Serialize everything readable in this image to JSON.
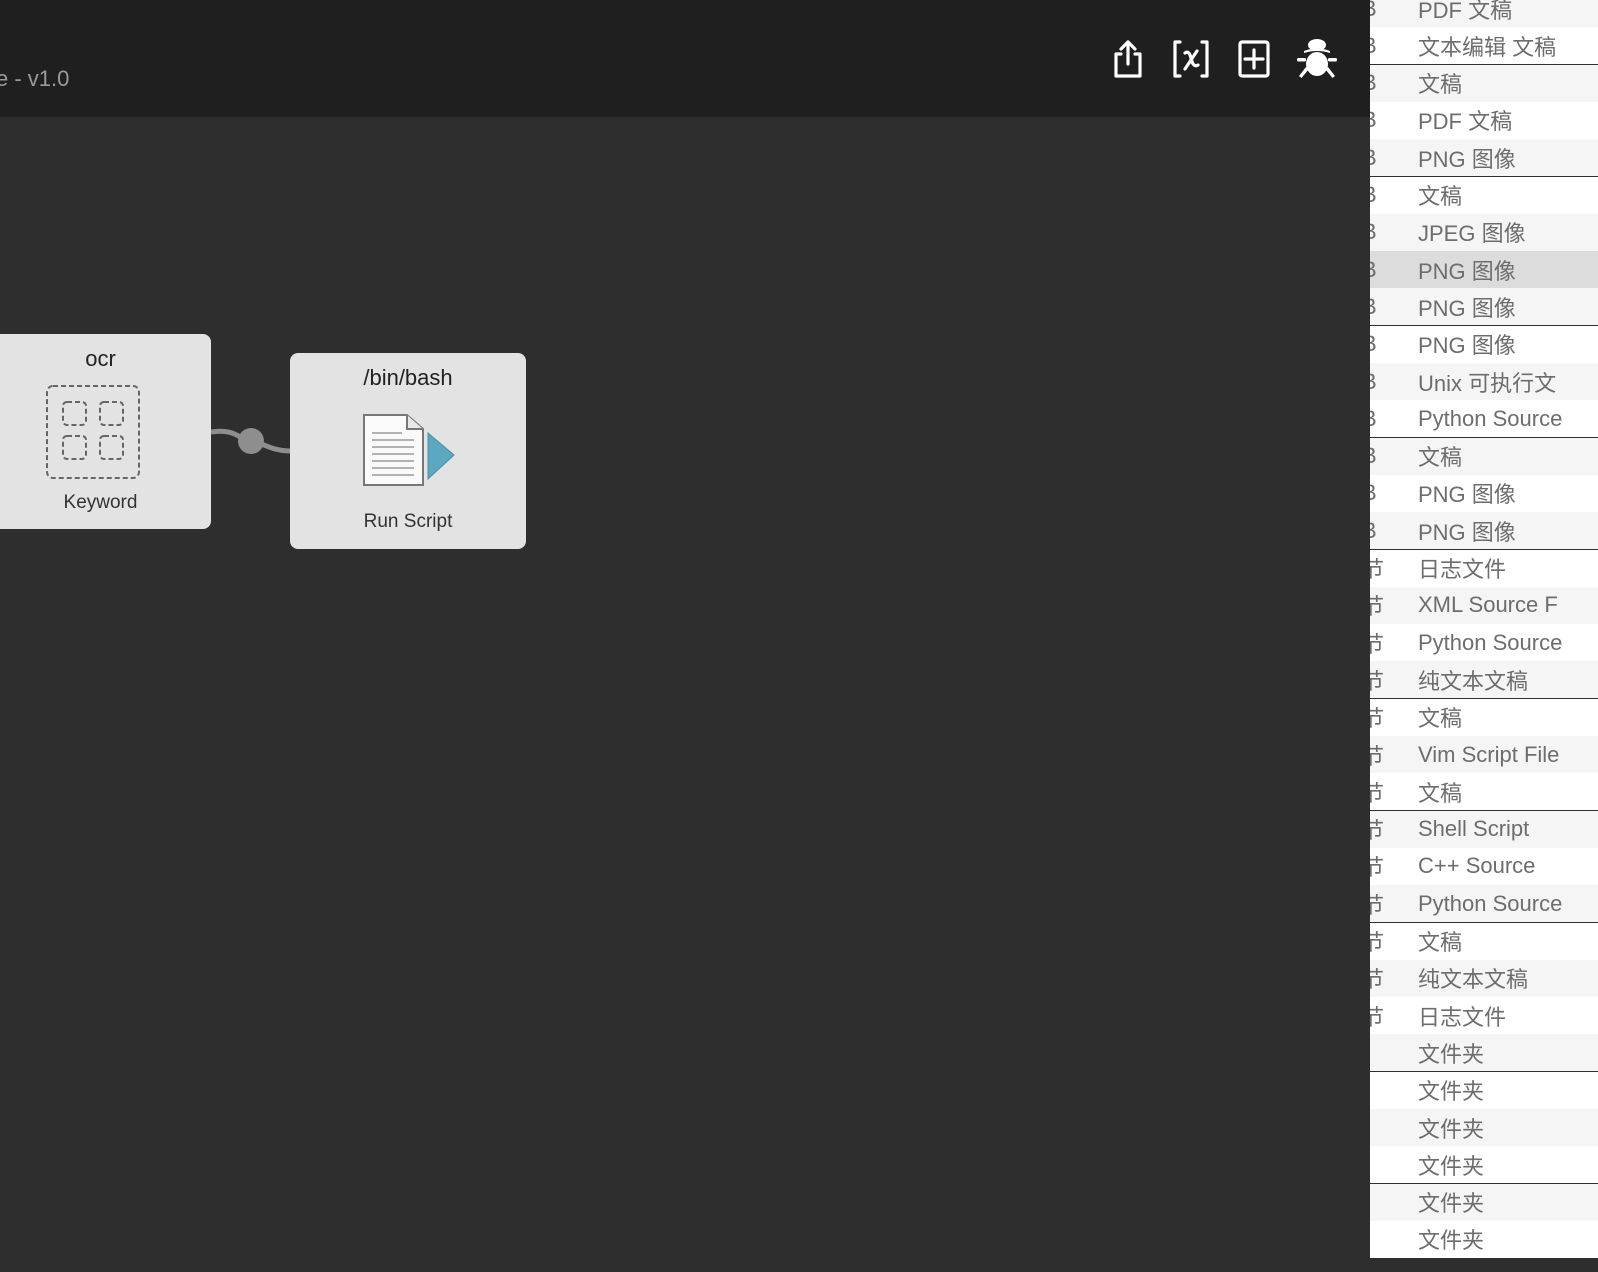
{
  "window": {
    "title": "e - v1.0"
  },
  "toolbar": {
    "icons": [
      "share-icon",
      "variables-icon",
      "add-icon",
      "debug-icon"
    ]
  },
  "nodes": {
    "keyword": {
      "title": "ocr",
      "label": "Keyword"
    },
    "script": {
      "title": "/bin/bash",
      "label": "Run Script"
    }
  },
  "file_list": {
    "rows": [
      {
        "size": "B",
        "kind": "PDF 文稿"
      },
      {
        "size": "B",
        "kind": "文本编辑 文稿"
      },
      {
        "size": "B",
        "kind": "文稿"
      },
      {
        "size": "B",
        "kind": "PDF 文稿"
      },
      {
        "size": "B",
        "kind": "PNG 图像"
      },
      {
        "size": "B",
        "kind": "文稿"
      },
      {
        "size": "B",
        "kind": "JPEG 图像"
      },
      {
        "size": "B",
        "kind": "PNG 图像",
        "selected": true
      },
      {
        "size": "B",
        "kind": "PNG 图像"
      },
      {
        "size": "B",
        "kind": "PNG 图像"
      },
      {
        "size": "B",
        "kind": "Unix 可执行文"
      },
      {
        "size": "B",
        "kind": "Python Source"
      },
      {
        "size": "B",
        "kind": "文稿"
      },
      {
        "size": "B",
        "kind": "PNG 图像"
      },
      {
        "size": "B",
        "kind": "PNG 图像"
      },
      {
        "size": "节",
        "kind": "日志文件"
      },
      {
        "size": "节",
        "kind": "XML Source F"
      },
      {
        "size": "节",
        "kind": "Python Source"
      },
      {
        "size": "节",
        "kind": "纯文本文稿"
      },
      {
        "size": "节",
        "kind": "文稿"
      },
      {
        "size": "节",
        "kind": "Vim Script File"
      },
      {
        "size": "节",
        "kind": "文稿"
      },
      {
        "size": "节",
        "kind": "Shell Script"
      },
      {
        "size": "节",
        "kind": "C++ Source"
      },
      {
        "size": "节",
        "kind": "Python Source"
      },
      {
        "size": "节",
        "kind": "文稿"
      },
      {
        "size": "节",
        "kind": "纯文本文稿"
      },
      {
        "size": "节",
        "kind": "日志文件"
      },
      {
        "size": "-",
        "kind": "文件夹"
      },
      {
        "size": "-",
        "kind": "文件夹"
      },
      {
        "size": "-",
        "kind": "文件夹"
      },
      {
        "size": "-",
        "kind": "文件夹"
      },
      {
        "size": "-",
        "kind": "文件夹"
      },
      {
        "size": "-",
        "kind": "文件夹"
      }
    ]
  },
  "colors": {
    "row_even": "#f5f5f5",
    "row_odd": "#ffffff",
    "row_selected": "#dcdcdc",
    "canvas": "#2e2e2e",
    "topbar": "#1f1f1f",
    "accent": "#5aa9c0"
  }
}
